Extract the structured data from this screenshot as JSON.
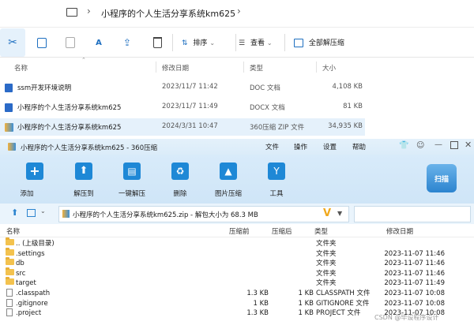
{
  "explorer": {
    "breadcrumb": {
      "folder": "小程序的个人生活分享系统km625"
    },
    "toolbar": {
      "sort_label": "排序",
      "view_label": "查看",
      "extract_label": "全部解压缩"
    },
    "columns": {
      "name": "名称",
      "modified": "修改日期",
      "type": "类型",
      "size": "大小"
    },
    "files": [
      {
        "name": "ssm开发环境说明",
        "date": "2023/11/7 11:42",
        "type": "DOC 文档",
        "size": "4,108 KB",
        "icon": "word-doc-icon"
      },
      {
        "name": "小程序的个人生活分享系统km625",
        "date": "2023/11/7 11:49",
        "type": "DOCX 文档",
        "size": "81 KB",
        "icon": "word-doc-icon"
      },
      {
        "name": "小程序的个人生活分享系统km625",
        "date": "2024/3/31 10:47",
        "type": "360压缩 ZIP 文件",
        "size": "34,935 KB",
        "icon": "zip-archive-icon"
      }
    ]
  },
  "zip": {
    "title": "小程序的个人生活分享系统km625 - 360压缩",
    "menu": [
      "文件",
      "操作",
      "设置",
      "帮助"
    ],
    "ribbon": [
      {
        "label": "添加",
        "icon": "add-icon"
      },
      {
        "label": "解压到",
        "icon": "extract-to-icon"
      },
      {
        "label": "一键解压",
        "icon": "one-click-extract-icon"
      },
      {
        "label": "删除",
        "icon": "delete-icon"
      },
      {
        "label": "图片压缩",
        "icon": "image-compress-icon"
      },
      {
        "label": "工具",
        "icon": "tools-icon"
      }
    ],
    "scan_label": "扫描",
    "path": "小程序的个人生活分享系统km625.zip - 解包大小为 68.3 MB",
    "columns": {
      "name": "名称",
      "compressed": "压缩前",
      "after": "压缩后",
      "type": "类型",
      "modified": "修改日期"
    },
    "rows": [
      {
        "name": ".. (上级目录)",
        "before": "",
        "after": "",
        "type": "文件夹",
        "date": "",
        "kind": "folder"
      },
      {
        "name": ".settings",
        "before": "",
        "after": "",
        "type": "文件夹",
        "date": "2023-11-07 11:46",
        "kind": "folder"
      },
      {
        "name": "db",
        "before": "",
        "after": "",
        "type": "文件夹",
        "date": "2023-11-07 11:46",
        "kind": "folder"
      },
      {
        "name": "src",
        "before": "",
        "after": "",
        "type": "文件夹",
        "date": "2023-11-07 11:46",
        "kind": "folder"
      },
      {
        "name": "target",
        "before": "",
        "after": "",
        "type": "文件夹",
        "date": "2023-11-07 11:49",
        "kind": "folder"
      },
      {
        "name": ".classpath",
        "before": "1.3 KB",
        "after": "1 KB",
        "type": "CLASSPATH 文件",
        "date": "2023-11-07 10:08",
        "kind": "file"
      },
      {
        "name": ".gitignore",
        "before": "1 KB",
        "after": "1 KB",
        "type": "GITIGNORE 文件",
        "date": "2023-11-07 10:08",
        "kind": "file"
      },
      {
        "name": ".project",
        "before": "1.3 KB",
        "after": "1 KB",
        "type": "PROJECT 文件",
        "date": "2023-11-07 10:08",
        "kind": "file"
      }
    ]
  },
  "watermark": "CSDN @毕设程序设计",
  "colors": {
    "accent": "#1e88d6",
    "selected_row": "#e5f1fb",
    "ribbon": "#d3e8f8"
  }
}
